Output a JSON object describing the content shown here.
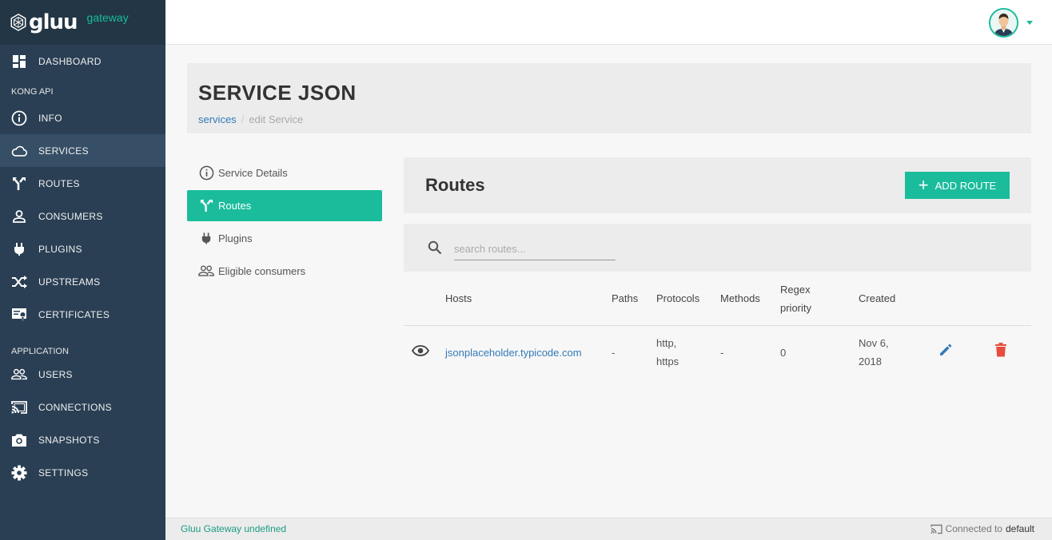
{
  "brand": {
    "name": "gluu",
    "sub": "gateway"
  },
  "sidebar": {
    "dashboard": "DASHBOARD",
    "section_kong": "KONG API",
    "kong_items": [
      "INFO",
      "SERVICES",
      "ROUTES",
      "CONSUMERS",
      "PLUGINS",
      "UPSTREAMS",
      "CERTIFICATES"
    ],
    "section_app": "APPLICATION",
    "app_items": [
      "USERS",
      "CONNECTIONS",
      "SNAPSHOTS",
      "SETTINGS"
    ],
    "active": "SERVICES"
  },
  "header": {
    "title": "SERVICE JSON",
    "breadcrumb": {
      "link": "services",
      "separator": "/",
      "current": "edit Service"
    }
  },
  "submenu": {
    "items": [
      "Service Details",
      "Routes",
      "Plugins",
      "Eligible consumers"
    ],
    "active": "Routes"
  },
  "routes": {
    "title": "Routes",
    "add_button": "ADD ROUTE",
    "search_placeholder": "search routes...",
    "columns": [
      "Hosts",
      "Paths",
      "Protocols",
      "Methods",
      "Regex priority",
      "Created"
    ],
    "rows": [
      {
        "host": "jsonplaceholder.typicode.com",
        "paths": "-",
        "protocols": [
          "http,",
          "https"
        ],
        "methods": "-",
        "regex_priority": "0",
        "created": [
          "Nov 6,",
          "2018"
        ]
      }
    ]
  },
  "footer": {
    "version": "Gluu Gateway undefined",
    "connection_label": "Connected to",
    "connection_name": "default"
  },
  "colors": {
    "accent": "#1abc9c",
    "sidebar": "#2a3f54",
    "link": "#337ab7",
    "delete": "#e74c3c"
  }
}
